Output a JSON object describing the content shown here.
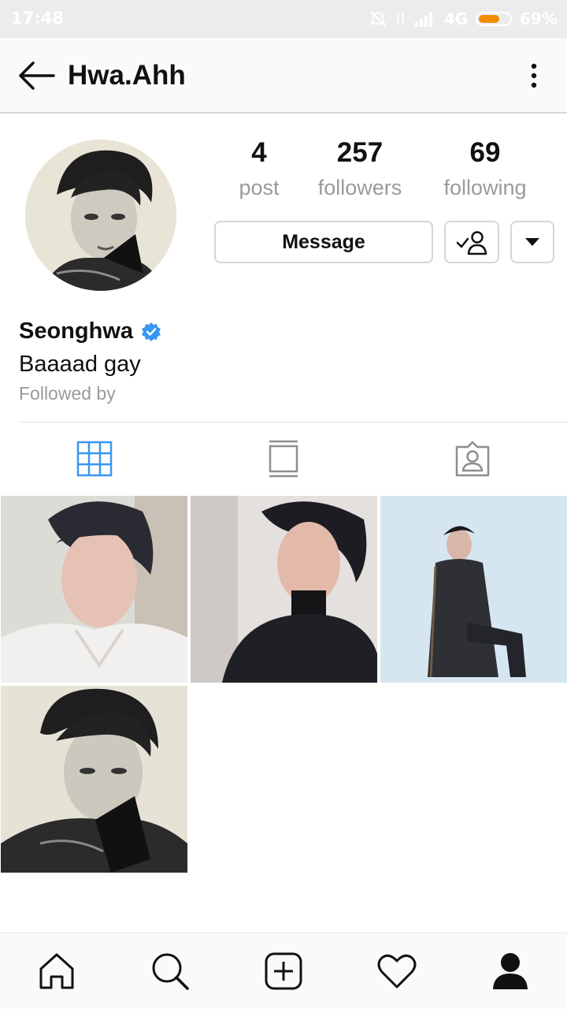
{
  "status_bar": {
    "time": "17:48",
    "network": "4G",
    "battery": "69%",
    "icons": [
      "mute-icon",
      "sim-icon",
      "signal-icon",
      "battery-icon"
    ],
    "battery_level": 0.69,
    "battery_color": "#f08c00"
  },
  "header": {
    "username": "Hwa.Ahh",
    "back_icon": "arrow-left-icon",
    "more_icon": "more-vertical-icon"
  },
  "profile": {
    "avatar_icon": "avatar-photo",
    "stats": [
      {
        "value": "4",
        "label": "post"
      },
      {
        "value": "257",
        "label": "followers"
      },
      {
        "value": "69",
        "label": "following"
      }
    ],
    "message_label": "Message",
    "following_icon": "user-check-icon",
    "dropdown_icon": "caret-down-icon",
    "name": "Seonghwa",
    "verified_icon": "verified-badge-icon",
    "verified_color": "#3897f0",
    "bio": "Baaaad gay",
    "followed_by": "Followed by"
  },
  "tabs": [
    {
      "name": "grid",
      "icon": "grid-icon",
      "active": true,
      "color": "#3897f0"
    },
    {
      "name": "igtv",
      "icon": "igtv-icon",
      "active": false,
      "color": "#8e8e8e"
    },
    {
      "name": "tagged",
      "icon": "tagged-icon",
      "active": false,
      "color": "#8e8e8e"
    }
  ],
  "posts": [
    {
      "icon": "photo-white-sweater"
    },
    {
      "icon": "photo-black-suit"
    },
    {
      "icon": "photo-seated-portrait"
    },
    {
      "icon": "photo-monochrome"
    }
  ],
  "bottom_nav": [
    {
      "name": "home",
      "icon": "home-icon"
    },
    {
      "name": "search",
      "icon": "search-icon"
    },
    {
      "name": "new-post",
      "icon": "plus-square-icon"
    },
    {
      "name": "activity",
      "icon": "heart-icon"
    },
    {
      "name": "profile",
      "icon": "person-icon"
    }
  ]
}
